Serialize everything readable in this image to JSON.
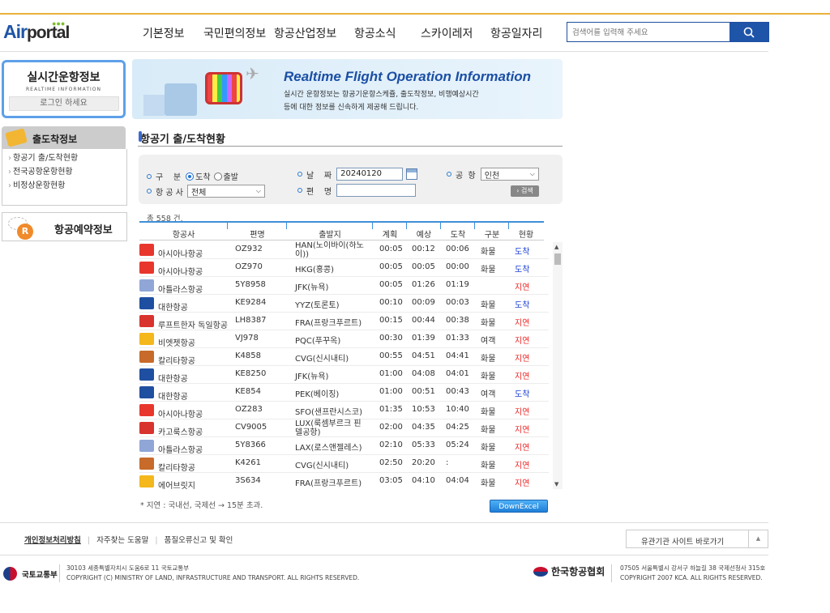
{
  "logo": {
    "part1": "Air",
    "part2": "portal",
    "dots": "●●●"
  },
  "gnb": [
    "기본정보",
    "국민편의정보",
    "항공산업정보",
    "항공소식",
    "스카이레저",
    "항공일자리"
  ],
  "search": {
    "placeholder": "검색어를 입력해 주세요",
    "icon": "search-icon"
  },
  "left": {
    "realtime_title": "실시간운항정보",
    "realtime_sub": "REALTIME INFORMATION",
    "login": "로그인 하세요",
    "dep_title": "출도착정보",
    "links": [
      "항공기 출/도착현황",
      "전국공항운항현황",
      "비정상운항현황"
    ],
    "resv_title": "항공예약정보",
    "resv_icon": "R"
  },
  "banner": {
    "title": "Realtime Flight Operation Information",
    "line1": "실시간 운항정보는 항공기운항스케쥴, 출도착정보, 비행예상시간",
    "line2": "등에 대한 정보를 신속하게 제공해 드립니다."
  },
  "section_title": "항공기 출/도착현황",
  "filter": {
    "gubun_label": "구    분",
    "radio_arr": "도착",
    "radio_dep": "출발",
    "airline_label": "항 공 사",
    "airline_value": "전체",
    "date_label": "날    짜",
    "date_value": "20240120",
    "flight_label": "편    명",
    "airport_label": "공  항",
    "airport_value": "인천",
    "search_btn": "› 검색"
  },
  "total": "총 558 건.",
  "columns": [
    "항공사",
    "편명",
    "출발지",
    "계획",
    "예상",
    "도착",
    "구분",
    "현황"
  ],
  "rows": [
    {
      "airline": "아시아나항공",
      "flight": "OZ932",
      "origin": "HAN(노이바이(하노이))",
      "plan": "00:05",
      "est": "00:12",
      "arr": "00:06",
      "type": "화물",
      "status": "도착",
      "logo": "#e8362d"
    },
    {
      "airline": "아시아나항공",
      "flight": "OZ970",
      "origin": "HKG(홍콩)",
      "plan": "00:05",
      "est": "00:05",
      "arr": "00:00",
      "type": "화물",
      "status": "도착",
      "logo": "#e8362d"
    },
    {
      "airline": "아틀라스항공",
      "flight": "5Y8958",
      "origin": "JFK(뉴욕)",
      "plan": "00:05",
      "est": "01:26",
      "arr": "01:19",
      "type": "",
      "status": "지연",
      "logo": "#8fa6d6"
    },
    {
      "airline": "대한항공",
      "flight": "KE9284",
      "origin": "YYZ(토론토)",
      "plan": "00:10",
      "est": "00:09",
      "arr": "00:03",
      "type": "화물",
      "status": "도착",
      "logo": "#1f4fa0"
    },
    {
      "airline": "루프트한자 독일항공",
      "flight": "LH8387",
      "origin": "FRA(프랑크푸르트)",
      "plan": "00:15",
      "est": "00:44",
      "arr": "00:38",
      "type": "화물",
      "status": "지연",
      "logo": "#d9332e"
    },
    {
      "airline": "비엣젯항공",
      "flight": "VJ978",
      "origin": "PQC(푸꾸옥)",
      "plan": "00:30",
      "est": "01:39",
      "arr": "01:33",
      "type": "여객",
      "status": "지연",
      "logo": "#f4b71c"
    },
    {
      "airline": "칼리타항공",
      "flight": "K4858",
      "origin": "CVG(신시내티)",
      "plan": "00:55",
      "est": "04:51",
      "arr": "04:41",
      "type": "화물",
      "status": "지연",
      "logo": "#c76a2a"
    },
    {
      "airline": "대한항공",
      "flight": "KE8250",
      "origin": "JFK(뉴욕)",
      "plan": "01:00",
      "est": "04:08",
      "arr": "04:01",
      "type": "화물",
      "status": "지연",
      "logo": "#1f4fa0"
    },
    {
      "airline": "대한항공",
      "flight": "KE854",
      "origin": "PEK(베이징)",
      "plan": "01:00",
      "est": "00:51",
      "arr": "00:43",
      "type": "여객",
      "status": "도착",
      "logo": "#1f4fa0"
    },
    {
      "airline": "아시아나항공",
      "flight": "OZ283",
      "origin": "SFO(샌프란시스코)",
      "plan": "01:35",
      "est": "10:53",
      "arr": "10:40",
      "type": "화물",
      "status": "지연",
      "logo": "#e8362d"
    },
    {
      "airline": "카고룩스항공",
      "flight": "CV9005",
      "origin": "LUX(룩셈부르크 핀델공항)",
      "plan": "02:00",
      "est": "04:35",
      "arr": "04:25",
      "type": "화물",
      "status": "지연",
      "logo": "#d9332e"
    },
    {
      "airline": "아틀라스항공",
      "flight": "5Y8366",
      "origin": "LAX(로스앤젤레스)",
      "plan": "02:10",
      "est": "05:33",
      "arr": "05:24",
      "type": "화물",
      "status": "지연",
      "logo": "#8fa6d6"
    },
    {
      "airline": "칼리타항공",
      "flight": "K4261",
      "origin": "CVG(신시내티)",
      "plan": "02:50",
      "est": "20:20",
      "arr": ":",
      "type": "화물",
      "status": "지연",
      "logo": "#c76a2a"
    },
    {
      "airline": "에어브릿지",
      "flight": "3S634",
      "origin": "FRA(프랑크푸르트)",
      "plan": "03:05",
      "est": "04:10",
      "arr": "04:04",
      "type": "화물",
      "status": "지연",
      "logo": "#f4b71c"
    }
  ],
  "note": "* 지연 : 국내선, 국제선 → 15분 초과.",
  "excel_btn": "DownExcel",
  "footer": {
    "links": [
      "개인정보처리방침",
      "자주찾는 도움말",
      "품질오류신고 및 확인"
    ],
    "related": "유관기관 사이트 바로가기",
    "molit_name": "국토교통부",
    "molit_addr1": "30103 세종특별자치시 도움6로 11 국토교통부",
    "molit_addr2": "COPYRIGHT (C) MINISTRY OF LAND, INFRASTRUCTURE AND TRANSPORT. ALL RIGHTS RESERVED.",
    "kca_name": "한국항공협회",
    "kca_addr1": "07505 서울특별시 강서구 하늘길 38 국제선청사 315호",
    "kca_addr2": "COPYRIGHT 2007 KCA. ALL RIGHTS RESERVED."
  }
}
